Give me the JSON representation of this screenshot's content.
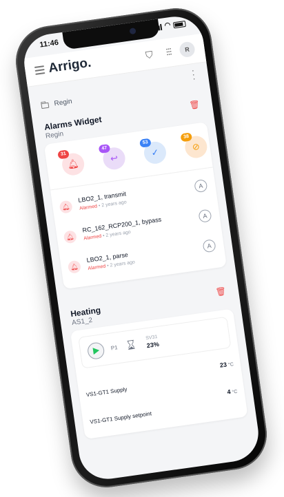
{
  "status_bar": {
    "time": "11:46"
  },
  "app": {
    "brand": "Arrigo.",
    "avatar_initial": "R"
  },
  "breadcrumb": {
    "label": "Regin"
  },
  "alarms_widget": {
    "title": "Alarms Widget",
    "subtitle": "Regin",
    "counters": [
      {
        "name": "alarmed",
        "count": "31",
        "icon": "bell-icon",
        "color": "#ef4444"
      },
      {
        "name": "returned",
        "count": "47",
        "icon": "return-arrow-icon",
        "color": "#a855f7"
      },
      {
        "name": "acknowledged",
        "count": "53",
        "icon": "checkmark-icon",
        "color": "#3b82f6"
      },
      {
        "name": "blocked",
        "count": "38",
        "icon": "blocked-icon",
        "color": "#f59e0b"
      }
    ],
    "alarms": [
      {
        "name": "LBO2_1, transmit",
        "state": "Alarmed",
        "time": "2 years ago",
        "ack_label": "A"
      },
      {
        "name": "RC_162_RCP200_1, bypass",
        "state": "Alarmed",
        "time": "2 years ago",
        "ack_label": "A"
      },
      {
        "name": "LBO2_1, parse",
        "state": "Alarmed",
        "time": "2 years ago",
        "ack_label": "A"
      }
    ]
  },
  "heating_widget": {
    "title": "Heating",
    "subtitle": "AS1_2",
    "pump_label": "P1",
    "valve_label": "SV31",
    "valve_value": "23%",
    "readings": [
      {
        "label": "VS1-GT1 Supply",
        "value": "23",
        "unit": "°C"
      },
      {
        "label": "VS1-GT1 Supply setpoint",
        "value": "4",
        "unit": "°C"
      }
    ]
  }
}
